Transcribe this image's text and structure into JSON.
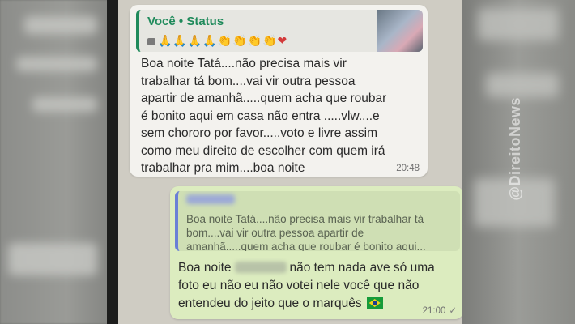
{
  "incoming": {
    "quote_author": "Você • Status",
    "quote_emojis": "🙏🙏🙏🙏👏👏👏👏",
    "quote_heart": "❤",
    "text": "Boa noite Tatá....não precisa mais vir\ntrabalhar tá bom....vai vir outra pessoa\napartir de amanhã.....quem acha que roubar\né bonito aqui em casa não entra .....vlw....e\nsem chororo por favor.....voto e livre assim\ncomo meu direito de escolher com quem irá\ntrabalhar pra mim....boa noite",
    "time": "20:48"
  },
  "outgoing": {
    "quoted_text": "Boa noite Tatá....não precisa mais vir trabalhar tá\nbom....vai vir outra pessoa apartir de\namanhã.....quem acha que roubar é bonito aqui...",
    "text_before": "Boa noite",
    "text_after": "não tem nada ave só uma foto eu não eu não votei nele você que não entendeu do jeito que o marquês",
    "time": "21:00",
    "tick": "✓"
  },
  "watermark": "@DireitoNews",
  "colors": {
    "status_accent": "#1f8a5b",
    "reply_accent": "#6a7fd6",
    "outgoing_bubble": "#dcecbf",
    "incoming_bubble": "#f3f2ee"
  },
  "icons": [
    "camera-icon",
    "brazil-flag-icon",
    "read-tick-icon"
  ]
}
